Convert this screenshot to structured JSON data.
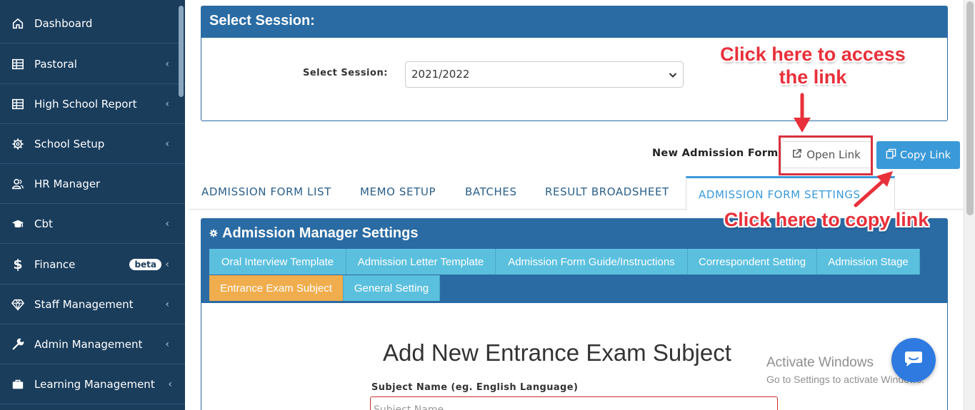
{
  "sidebar": {
    "items": [
      {
        "label": "Dashboard",
        "icon": "home-icon",
        "chevron": false
      },
      {
        "label": "Pastoral",
        "icon": "table-icon",
        "chevron": true
      },
      {
        "label": "High School Report",
        "icon": "table-icon",
        "chevron": true
      },
      {
        "label": "School Setup",
        "icon": "gear-icon",
        "chevron": true
      },
      {
        "label": "HR Manager",
        "icon": "users-icon",
        "chevron": false
      },
      {
        "label": "Cbt",
        "icon": "graduation-cap-icon",
        "chevron": true
      },
      {
        "label": "Finance",
        "icon": "dollar-icon",
        "chevron": true,
        "badge": "beta"
      },
      {
        "label": "Staff Management",
        "icon": "diamond-icon",
        "chevron": true
      },
      {
        "label": "Admin Management",
        "icon": "wrench-icon",
        "chevron": true
      },
      {
        "label": "Learning Management",
        "icon": "briefcase-icon",
        "chevron": true
      }
    ],
    "chevron_glyph": "‹"
  },
  "session": {
    "heading": "Select Session:",
    "label": "Select Session:",
    "selected": "2021/2022"
  },
  "admission_link": {
    "label": "New Admission Form:",
    "open_label": "Open Link",
    "copy_label": "Copy Link"
  },
  "tabs": [
    "ADMISSION FORM LIST",
    "MEMO SETUP",
    "BATCHES",
    "RESULT BROADSHEET",
    "ADMISSION FORM SETTINGS"
  ],
  "active_tab": "ADMISSION FORM SETTINGS",
  "settings": {
    "heading": "Admission Manager Settings",
    "subtabs": [
      "Oral Interview Template",
      "Admission Letter Template",
      "Admission Form Guide/Instructions",
      "Correspondent Setting",
      "Admission Stage",
      "Entrance Exam Subject",
      "General Setting"
    ],
    "active_subtab": "Entrance Exam Subject"
  },
  "form": {
    "title": "Add New Entrance Exam Subject",
    "subject_label": "Subject Name (eg. English Language)",
    "subject_placeholder": "Subject Name"
  },
  "annotations": {
    "access_line1": "Click here to access",
    "access_line2": "the link",
    "copy": "Click here to copy link"
  },
  "watermark": {
    "line1": "Activate Windows",
    "line2": "Go to Settings to activate Windows."
  },
  "colors": {
    "sidebar": "#1a3d5c",
    "panel_header": "#2a6ba4",
    "subtab": "#5bc0de",
    "subtab_active": "#f0ad4e",
    "copy_button": "#3a9ad9",
    "annotation": "#e8303a",
    "chat_button": "#2e7ae0"
  }
}
